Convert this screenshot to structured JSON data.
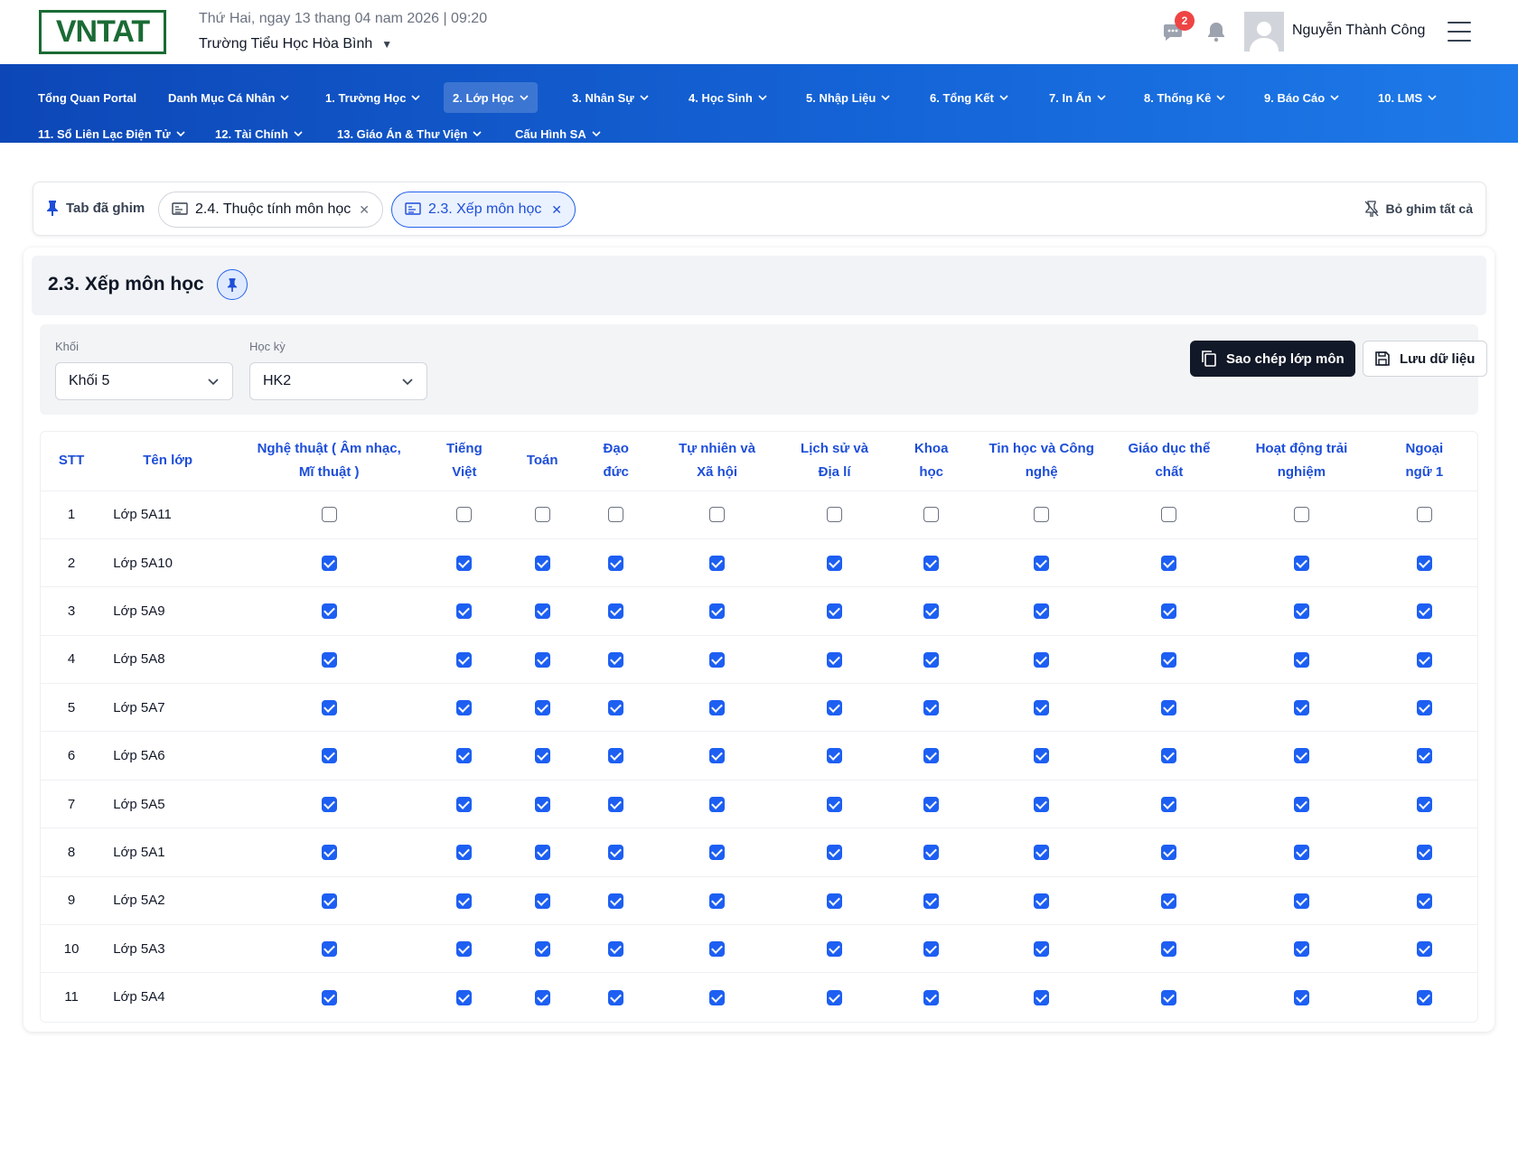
{
  "header": {
    "logo_text": "VNTAT",
    "date_line": "Thứ Hai, ngay 13 thang 04 nam 2026 | 09:20",
    "school_name": "Trường Tiểu Học Hòa Bình",
    "message_badge": "2",
    "user_name": "Nguyễn Thành Công"
  },
  "nav": {
    "row1": [
      "Tổng Quan Portal",
      "Danh Mục Cá Nhân",
      "1. Trường Học",
      "2. Lớp Học",
      "3. Nhân Sự",
      "4. Học Sinh",
      "5. Nhập Liệu",
      "6. Tổng Kết",
      "7. In Ấn",
      "8. Thống Kê",
      "9. Báo Cáo",
      "10. LMS"
    ],
    "row2": [
      "11. Sổ Liên Lạc Điện Tử",
      "12. Tài Chính",
      "13. Giáo Án & Thư Viện",
      "Cấu Hình SA"
    ],
    "active": "2. Lớp Học"
  },
  "pinned": {
    "label": "Tab đã ghim",
    "tabs": [
      "2.4. Thuộc tính môn học",
      "2.3. Xếp môn học"
    ],
    "active_tab": "2.3. Xếp môn học",
    "unpin_all": "Bỏ ghim tất cả"
  },
  "page": {
    "title": "2.3. Xếp môn học",
    "filters": {
      "grade_label": "Khối",
      "grade_value": "Khối 5",
      "semester_label": "Học kỳ",
      "semester_value": "HK2"
    },
    "buttons": {
      "copy": "Sao chép lớp môn",
      "save": "Lưu dữ liệu"
    }
  },
  "table": {
    "headers": {
      "stt": "STT",
      "class_name": "Tên lớp",
      "subjects": [
        [
          "Nghệ thuật ( Âm nhạc,",
          "Mĩ thuật )"
        ],
        [
          "Tiếng",
          "Việt"
        ],
        [
          "Toán"
        ],
        [
          "Đạo",
          "đức"
        ],
        [
          "Tự nhiên và",
          "Xã hội"
        ],
        [
          "Lịch sử và",
          "Địa lí"
        ],
        [
          "Khoa",
          "học"
        ],
        [
          "Tin học và Công",
          "nghệ"
        ],
        [
          "Giáo dục thể",
          "chất"
        ],
        [
          "Hoạt động trải",
          "nghiệm"
        ],
        [
          "Ngoại",
          "ngữ 1"
        ]
      ]
    },
    "rows": [
      {
        "stt": "1",
        "name": "Lớp 5A11",
        "checked": [
          false,
          false,
          false,
          false,
          false,
          false,
          false,
          false,
          false,
          false,
          false
        ]
      },
      {
        "stt": "2",
        "name": "Lớp 5A10",
        "checked": [
          true,
          true,
          true,
          true,
          true,
          true,
          true,
          true,
          true,
          true,
          true
        ]
      },
      {
        "stt": "3",
        "name": "Lớp 5A9",
        "checked": [
          true,
          true,
          true,
          true,
          true,
          true,
          true,
          true,
          true,
          true,
          true
        ]
      },
      {
        "stt": "4",
        "name": "Lớp 5A8",
        "checked": [
          true,
          true,
          true,
          true,
          true,
          true,
          true,
          true,
          true,
          true,
          true
        ]
      },
      {
        "stt": "5",
        "name": "Lớp 5A7",
        "checked": [
          true,
          true,
          true,
          true,
          true,
          true,
          true,
          true,
          true,
          true,
          true
        ]
      },
      {
        "stt": "6",
        "name": "Lớp 5A6",
        "checked": [
          true,
          true,
          true,
          true,
          true,
          true,
          true,
          true,
          true,
          true,
          true
        ]
      },
      {
        "stt": "7",
        "name": "Lớp 5A5",
        "checked": [
          true,
          true,
          true,
          true,
          true,
          true,
          true,
          true,
          true,
          true,
          true
        ]
      },
      {
        "stt": "8",
        "name": "Lớp 5A1",
        "checked": [
          true,
          true,
          true,
          true,
          true,
          true,
          true,
          true,
          true,
          true,
          true
        ]
      },
      {
        "stt": "9",
        "name": "Lớp 5A2",
        "checked": [
          true,
          true,
          true,
          true,
          true,
          true,
          true,
          true,
          true,
          true,
          true
        ]
      },
      {
        "stt": "10",
        "name": "Lớp 5A3",
        "checked": [
          true,
          true,
          true,
          true,
          true,
          true,
          true,
          true,
          true,
          true,
          true
        ]
      },
      {
        "stt": "11",
        "name": "Lớp 5A4",
        "checked": [
          true,
          true,
          true,
          true,
          true,
          true,
          true,
          true,
          true,
          true,
          true
        ]
      }
    ]
  },
  "colors": {
    "nav_start": "#0d47b7",
    "nav_end": "#1e7ae8",
    "accent": "#1d4ed8",
    "checkbox": "#1d5ff2",
    "logo": "#1a6b34",
    "badge": "#ef4444"
  }
}
